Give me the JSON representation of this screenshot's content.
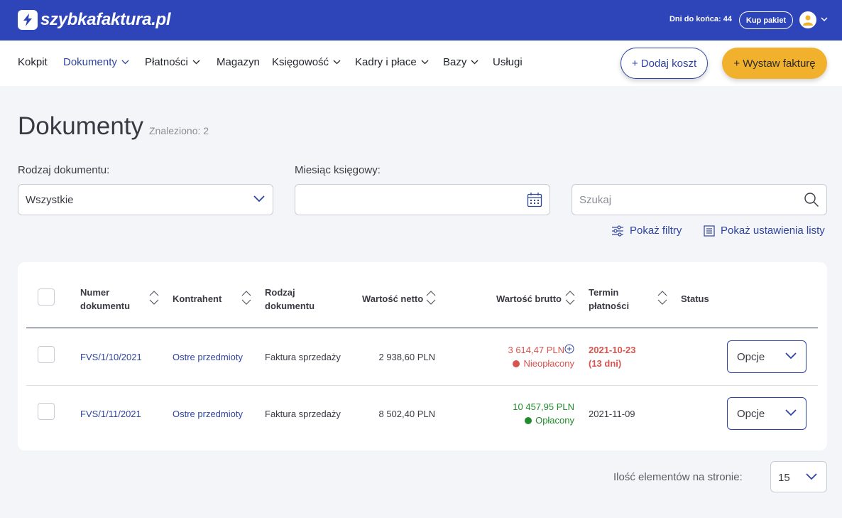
{
  "header": {
    "logo_text": "szybkafaktura.pl",
    "days_left": "Dni do końca: 44",
    "buy_package": "Kup pakiet"
  },
  "nav": {
    "items": [
      {
        "label": "Kokpit",
        "dropdown": false
      },
      {
        "label": "Dokumenty",
        "dropdown": true,
        "active": true
      },
      {
        "label": "Płatności",
        "dropdown": true
      },
      {
        "label": "Magazyn",
        "dropdown": false
      },
      {
        "label": "Księgowość",
        "dropdown": true
      },
      {
        "label": "Kadry i płace",
        "dropdown": true
      },
      {
        "label": "Bazy",
        "dropdown": true
      },
      {
        "label": "Usługi",
        "dropdown": false
      }
    ],
    "add_cost": "+ Dodaj koszt",
    "issue_invoice": "+ Wystaw fakturę"
  },
  "page": {
    "title": "Dokumenty",
    "found": "Znaleziono: 2"
  },
  "filters": {
    "doc_type_label": "Rodzaj dokumentu:",
    "doc_type_value": "Wszystkie",
    "month_label": "Miesiąc księgowy:",
    "month_value": "",
    "search_placeholder": "Szukaj",
    "show_filters": "Pokaż filtry",
    "show_list_settings": "Pokaż ustawienia listy"
  },
  "table": {
    "columns": {
      "number": "Numer dokumentu",
      "contractor": "Kontrahent",
      "doc_type": "Rodzaj dokumentu",
      "net": "Wartość netto",
      "gross": "Wartość brutto",
      "due": "Termin płatności",
      "status": "Status"
    },
    "rows": [
      {
        "number": "FVS/1/10/2021",
        "contractor": "Ostre przedmioty",
        "doc_type": "Faktura sprzedaży",
        "net": "2 938,60 PLN",
        "gross": "3 614,47 PLN",
        "payment_status": "Nieopłacony",
        "due_date": "2021-10-23",
        "due_note": "(13 dni)",
        "options": "Opcje",
        "status_color": "#d9534f"
      },
      {
        "number": "FVS/1/11/2021",
        "contractor": "Ostre przedmioty",
        "doc_type": "Faktura sprzedaży",
        "net": "8 502,40 PLN",
        "gross": "10 457,95 PLN",
        "payment_status": "Opłacony",
        "due_date": "2021-11-09",
        "due_note": "",
        "options": "Opcje",
        "status_color": "#208c2c"
      }
    ]
  },
  "pagination": {
    "per_page_label": "Ilość elementów na stronie:",
    "per_page_value": "15"
  },
  "colors": {
    "brand_blue": "#2e44b9",
    "accent_yellow": "#f2b12c",
    "link_blue": "#2e44a0"
  }
}
